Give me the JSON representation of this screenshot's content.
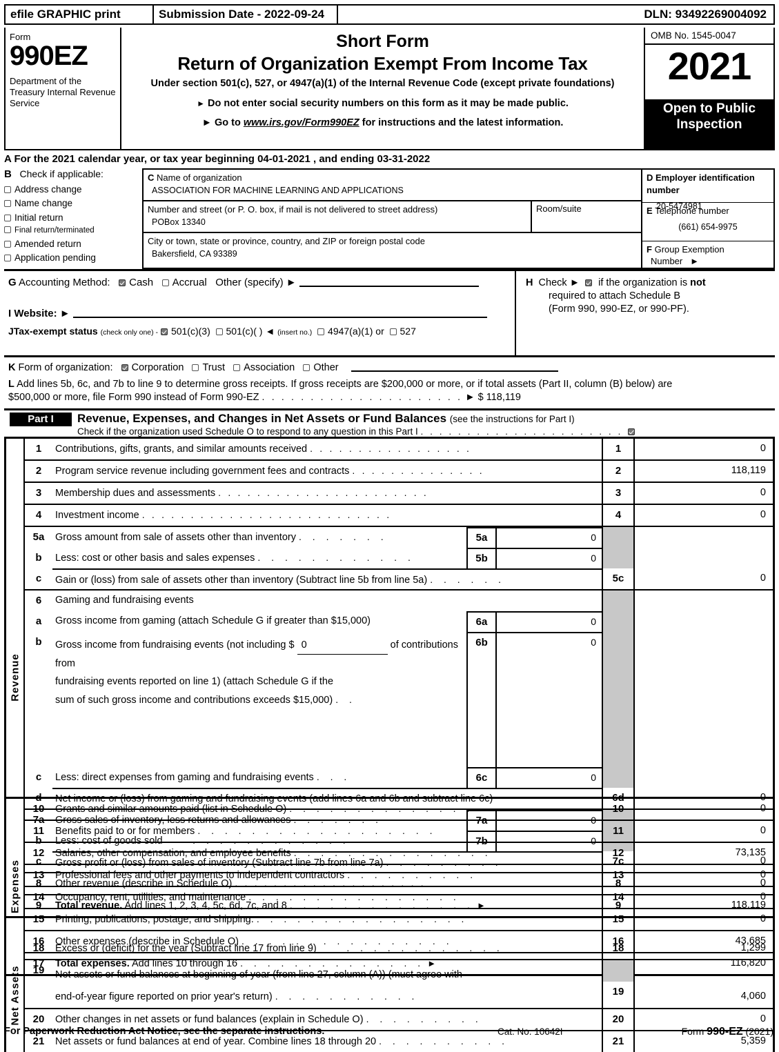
{
  "efile": {
    "graphic_print": "efile GRAPHIC print",
    "submission_date": "Submission Date - 2022-09-24",
    "dln": "DLN: 93492269004092"
  },
  "masthead": {
    "form_label": "Form",
    "form_number": "990EZ",
    "department": "Department of the Treasury Internal Revenue Service",
    "title1": "Short Form",
    "title2": "Return of Organization Exempt From Income Tax",
    "subtitle": "Under section 501(c), 527, or 4947(a)(1) of the Internal Revenue Code (except private foundations)",
    "bullet1": "Do not enter social security numbers on this form as it may be made public.",
    "bullet2_pre": "Go to",
    "bullet2_link": "www.irs.gov/Form990EZ",
    "bullet2_post": "for instructions and the latest information.",
    "omb": "OMB No. 1545-0047",
    "year": "2021",
    "open_to_public": "Open to Public Inspection"
  },
  "line_a": "A  For the 2021 calendar year, or tax year beginning 04-01-2021 , and ending 03-31-2022",
  "section_b": {
    "letter": "B",
    "heading": "Check if applicable:",
    "items": [
      {
        "label": "Address change",
        "checked": false
      },
      {
        "label": "Name change",
        "checked": false
      },
      {
        "label": "Initial return",
        "checked": false
      },
      {
        "label": "Final return/terminated",
        "checked": false
      },
      {
        "label": "Amended return",
        "checked": false
      },
      {
        "label": "Application pending",
        "checked": false
      }
    ]
  },
  "section_c": {
    "letter": "C",
    "name_header": "Name of organization",
    "name_value": "ASSOCIATION FOR MACHINE LEARNING AND APPLICATIONS",
    "street_header": "Number and street (or P. O. box, if mail is not delivered to street address)",
    "street_value": "POBox 13340",
    "room_header": "Room/suite",
    "room_value": "",
    "city_header": "City or town, state or province, country, and ZIP or foreign postal code",
    "city_value": "Bakersfield, CA   93389"
  },
  "section_d": {
    "letter": "D",
    "header": "Employer identification number",
    "value": "20-5474981"
  },
  "section_e": {
    "letter": "E",
    "header": "Telephone number",
    "value": "(661) 654-9975"
  },
  "section_f": {
    "letter": "F",
    "header": "Group Exemption",
    "subheader": "Number"
  },
  "section_g": {
    "letter": "G",
    "label": "Accounting Method:",
    "cash": "Cash",
    "cash_checked": true,
    "accrual": "Accrual",
    "accrual_checked": false,
    "other": "Other (specify)"
  },
  "section_h": {
    "letter": "H",
    "line1_pre": "Check",
    "line1_checked": true,
    "line1_post_a": "if the organization is",
    "line1_post_b": "not",
    "line2": "required to attach Schedule B",
    "line3": "(Form 990, 990-EZ, or 990-PF)."
  },
  "section_i": {
    "letter": "I",
    "label": "Website:",
    "value": ""
  },
  "section_j": {
    "letter": "J",
    "label": "Tax-exempt status",
    "note": "(check only one) -",
    "options": [
      {
        "label": "501(c)(3)",
        "checked": true
      },
      {
        "label": "501(c)(   )",
        "checked": false
      },
      {
        "label": "4947(a)(1) or",
        "checked": false
      },
      {
        "label": "527",
        "checked": false
      }
    ],
    "insert_no": "(insert no.)"
  },
  "section_k": {
    "letter": "K",
    "label": "Form of organization:",
    "options": [
      {
        "label": "Corporation",
        "checked": true
      },
      {
        "label": "Trust",
        "checked": false
      },
      {
        "label": "Association",
        "checked": false
      },
      {
        "label": "Other",
        "checked": false
      }
    ]
  },
  "section_l": {
    "letter": "L",
    "text_line1": "Add lines 5b, 6c, and 7b to line 9 to determine gross receipts. If gross receipts are $200,000 or more, or if total assets (Part II, column (B) below) are",
    "text_line2": "$500,000 or more, file Form 990 instead of Form 990-EZ",
    "amount": "$ 118,119"
  },
  "part_i": {
    "tag": "Part I",
    "title": "Revenue, Expenses, and Changes in Net Assets or Fund Balances",
    "title_note": "(see the instructions for Part I)",
    "schedule_o_text": "Check if the organization used Schedule O to respond to any question in this Part I",
    "schedule_o_checked": true
  },
  "revenue_label": "Revenue",
  "expenses_label": "Expenses",
  "net_assets_label": "Net Assets",
  "revenue_rows": [
    {
      "no": "1",
      "desc": "Contributions, gifts, grants, and similar amounts received",
      "main_no": "1",
      "amount": "0"
    },
    {
      "no": "2",
      "desc": "Program service revenue including government fees and contracts",
      "main_no": "2",
      "amount": "118,119"
    },
    {
      "no": "3",
      "desc": "Membership dues and assessments",
      "main_no": "3",
      "amount": "0"
    },
    {
      "no": "4",
      "desc": "Investment income",
      "main_no": "4",
      "amount": "0"
    },
    {
      "no": "5a",
      "desc": "Gross amount from sale of assets other than inventory",
      "sub_no": "5a",
      "sub_value": "0"
    },
    {
      "no": "b",
      "desc": "Less: cost or other basis and sales expenses",
      "sub_no": "5b",
      "sub_value": "0"
    },
    {
      "no": "c",
      "desc": "Gain or (loss) from sale of assets other than inventory (Subtract line 5b from line 5a)",
      "main_no": "5c",
      "amount": "0"
    },
    {
      "no": "6",
      "desc": "Gaming and fundraising events"
    },
    {
      "no": "a",
      "desc": "Gross income from gaming (attach Schedule G if greater than $15,000)",
      "sub_no": "6a",
      "sub_value": "0"
    },
    {
      "no": "b",
      "desc_l1": "Gross income from fundraising events (not including $",
      "desc_inline_value": "0",
      "desc_l1b": "of contributions from",
      "desc_l2": "fundraising events reported on line 1) (attach Schedule G if the",
      "desc_l3": "sum of such gross income and contributions exceeds $15,000)",
      "sub_no": "6b",
      "sub_value": "0"
    },
    {
      "no": "c",
      "desc": "Less: direct expenses from gaming and fundraising events",
      "sub_no": "6c",
      "sub_value": "0"
    },
    {
      "no": "d",
      "desc": "Net income or (loss) from gaming and fundraising events (add lines 6a and 6b and subtract line 6c)",
      "main_no": "6d",
      "amount": "0"
    },
    {
      "no": "7a",
      "desc": "Gross sales of inventory, less returns and allowances",
      "sub_no": "7a",
      "sub_value": "0"
    },
    {
      "no": "b",
      "desc": "Less: cost of goods sold",
      "sub_no": "7b",
      "sub_value": "0"
    },
    {
      "no": "c",
      "desc": "Gross profit or (loss) from sales of inventory (Subtract line 7b from line 7a)",
      "main_no": "7c",
      "amount": "0"
    },
    {
      "no": "8",
      "desc": "Other revenue (describe in Schedule O)",
      "main_no": "8",
      "amount": "0"
    },
    {
      "no": "9",
      "desc_bold": "Total revenue.",
      "desc": "Add lines 1, 2, 3, 4, 5c, 6d, 7c, and 8",
      "main_no": "9",
      "amount": "118,119"
    }
  ],
  "expense_rows": [
    {
      "no": "10",
      "desc": "Grants and similar amounts paid (list in Schedule O)",
      "main_no": "10",
      "amount": "0"
    },
    {
      "no": "11",
      "desc": "Benefits paid to or for members",
      "main_no": "11",
      "amount": "0"
    },
    {
      "no": "12",
      "desc": "Salaries, other compensation, and employee benefits",
      "main_no": "12",
      "amount": "73,135"
    },
    {
      "no": "13",
      "desc": "Professional fees and other payments to independent contractors",
      "main_no": "13",
      "amount": "0"
    },
    {
      "no": "14",
      "desc": "Occupancy, rent, utilities, and maintenance",
      "main_no": "14",
      "amount": "0"
    },
    {
      "no": "15",
      "desc": "Printing, publications, postage, and shipping.",
      "main_no": "15",
      "amount": "0"
    },
    {
      "no": "16",
      "desc": "Other expenses (describe in Schedule O)",
      "main_no": "16",
      "amount": "43,685"
    },
    {
      "no": "17",
      "desc_bold": "Total expenses.",
      "desc": "Add lines 10 through 16",
      "main_no": "17",
      "amount": "116,820"
    }
  ],
  "net_asset_rows": [
    {
      "no": "18",
      "desc": "Excess or (deficit) for the year (Subtract line 17 from line 9)",
      "main_no": "18",
      "amount": "1,299"
    },
    {
      "no": "19",
      "desc_l1": "Net assets or fund balances at beginning of year (from line 27, column (A)) (must agree with",
      "desc_l2": "end-of-year figure reported on prior year's return)",
      "main_no": "19",
      "amount": "4,060"
    },
    {
      "no": "20",
      "desc": "Other changes in net assets or fund balances (explain in Schedule O)",
      "main_no": "20",
      "amount": "0"
    },
    {
      "no": "21",
      "desc": "Net assets or fund balances at end of year. Combine lines 18 through 20",
      "main_no": "21",
      "amount": "5,359"
    }
  ],
  "footer": {
    "left": "For Paperwork Reduction Act Notice, see the separate instructions.",
    "center": "Cat. No. 10642I",
    "right_pre": "Form",
    "right_bold": "990-EZ",
    "right_post": "(2021)"
  }
}
